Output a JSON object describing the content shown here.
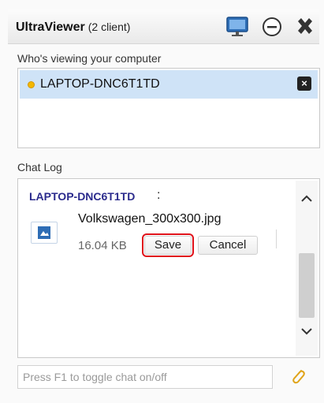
{
  "window": {
    "app_name": "UltraViewer",
    "clients": "(2 client)",
    "icons": {
      "monitor": "monitor-icon",
      "minimize": "minimize-icon",
      "close": "close-icon"
    }
  },
  "viewers": {
    "heading": "Who's viewing your computer",
    "items": [
      {
        "name": "LAPTOP-DNC6T1TD",
        "status_color": "#f4b800"
      }
    ]
  },
  "chat": {
    "heading": "Chat Log",
    "sender": "LAPTOP-DNC6T1TD",
    "colon": ":",
    "file": {
      "name": "Volkswagen_300x300.jpg",
      "size": "16.04 KB",
      "save_label": "Save",
      "cancel_label": "Cancel"
    },
    "scroll_up": "^",
    "scroll_down": "v"
  },
  "input": {
    "placeholder": "Press F1 to toggle chat on/off"
  },
  "colors": {
    "selected_row": "#cfe3f7",
    "sender": "#2a2a8c",
    "highlight": "#e0131b"
  }
}
